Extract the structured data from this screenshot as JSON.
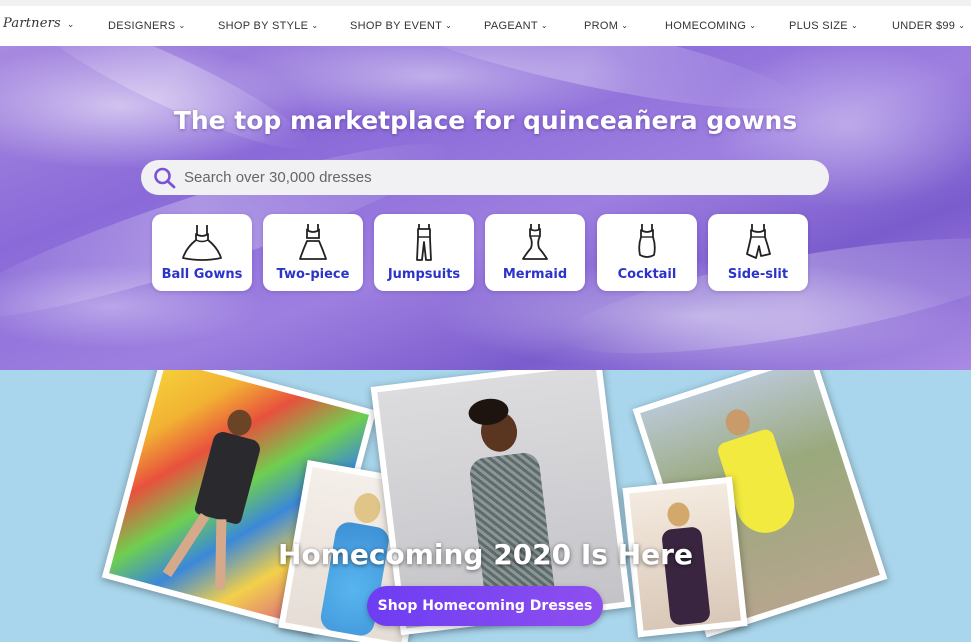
{
  "nav": {
    "logo": "Partners",
    "items": [
      {
        "label": "DESIGNERS"
      },
      {
        "label": "SHOP BY STYLE"
      },
      {
        "label": "SHOP BY EVENT"
      },
      {
        "label": "PAGEANT"
      },
      {
        "label": "PROM"
      },
      {
        "label": "HOMECOMING"
      },
      {
        "label": "PLUS SIZE"
      },
      {
        "label": "UNDER $99"
      }
    ]
  },
  "hero": {
    "title": "The top marketplace for quinceañera gowns",
    "search": {
      "placeholder": "Search over 30,000 dresses",
      "icon": "search-icon"
    },
    "categories": [
      {
        "label": "Ball Gowns",
        "icon": "ball-gown-icon"
      },
      {
        "label": "Two-piece",
        "icon": "two-piece-icon"
      },
      {
        "label": "Jumpsuits",
        "icon": "jumpsuit-icon"
      },
      {
        "label": "Mermaid",
        "icon": "mermaid-icon"
      },
      {
        "label": "Cocktail",
        "icon": "cocktail-icon"
      },
      {
        "label": "Side-slit",
        "icon": "side-slit-icon"
      }
    ]
  },
  "promo": {
    "heading": "Homecoming 2020 Is Here",
    "cta": "Shop Homecoming Dresses"
  },
  "colors": {
    "accent": "#2b34c9",
    "cta": "#7a44f1",
    "promo_bg": "#a9d6ec",
    "hero_purple": "#8a6ad8"
  }
}
